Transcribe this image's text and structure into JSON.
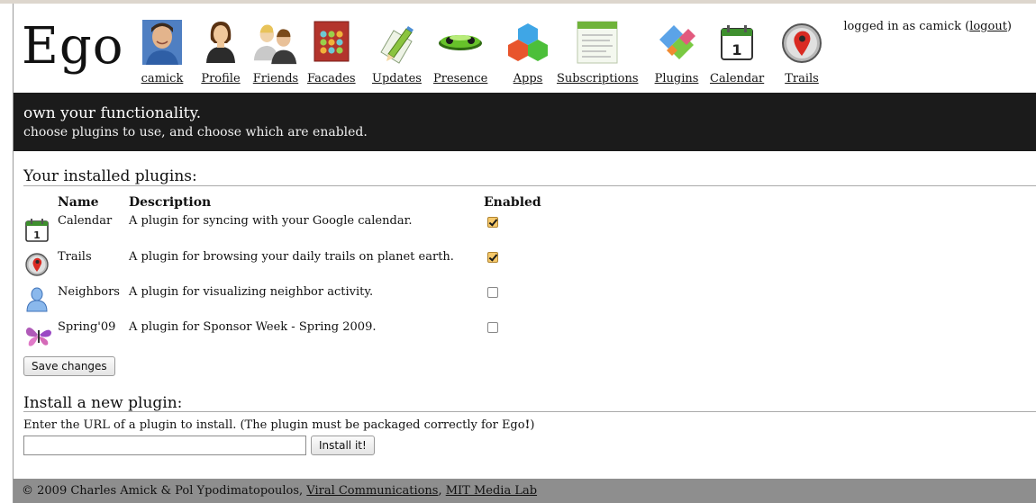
{
  "header": {
    "logo": "Ego",
    "nav": [
      {
        "label": "camick",
        "icon": "user-avatar-icon"
      },
      {
        "label": "Profile",
        "icon": "person-icon"
      },
      {
        "label": "Friends",
        "icon": "friends-icon"
      },
      {
        "label": "Facades",
        "icon": "facades-grid-icon"
      },
      {
        "label": "Updates",
        "icon": "pencil-paper-icon"
      },
      {
        "label": "Presence",
        "icon": "presence-pill-icon"
      },
      {
        "label": "Apps",
        "icon": "apps-cubes-icon"
      },
      {
        "label": "Subscriptions",
        "icon": "subscriptions-page-icon"
      },
      {
        "label": "Plugins",
        "icon": "plugins-puzzle-icon"
      },
      {
        "label": "Calendar",
        "icon": "calendar-icon"
      },
      {
        "label": "Trails",
        "icon": "map-pin-icon"
      }
    ],
    "login_prefix": "logged in as camick (",
    "logout_label": "logout",
    "login_suffix": ")"
  },
  "banner": {
    "title": "own your functionality.",
    "subtitle": "choose plugins to use, and choose which are enabled."
  },
  "installed": {
    "title": "Your installed plugins:",
    "columns": {
      "name": "Name",
      "description": "Description",
      "enabled": "Enabled"
    },
    "plugins": [
      {
        "name": "Calendar",
        "description": "A plugin for syncing with your Google calendar.",
        "enabled": true,
        "icon": "calendar-icon"
      },
      {
        "name": "Trails",
        "description": "A plugin for browsing your daily trails on planet earth.",
        "enabled": true,
        "icon": "map-pin-icon"
      },
      {
        "name": "Neighbors",
        "description": "A plugin for visualizing neighbor activity.",
        "enabled": false,
        "icon": "person-silhouette-icon"
      },
      {
        "name": "Spring'09",
        "description": "A plugin for Sponsor Week - Spring 2009.",
        "enabled": false,
        "icon": "butterfly-icon"
      }
    ],
    "save_label": "Save changes"
  },
  "install": {
    "title": "Install a new plugin:",
    "instructions_prefix": "Enter the URL of a plugin to install. (The plugin must be packaged correctly for Ego",
    "instructions_bang": "!",
    "instructions_suffix": ")",
    "url_value": "",
    "button_label": "Install it!"
  },
  "footer": {
    "prefix": "© 2009 Charles Amick & Pol Ypodimatopoulos, ",
    "link1": "Viral Communications",
    "separator": ", ",
    "link2": "MIT Media Lab"
  },
  "colors": {
    "banner_bg": "#1b1b1b",
    "footer_bg": "#8e8e8e",
    "checkbox_checked": "#f6c96b"
  }
}
